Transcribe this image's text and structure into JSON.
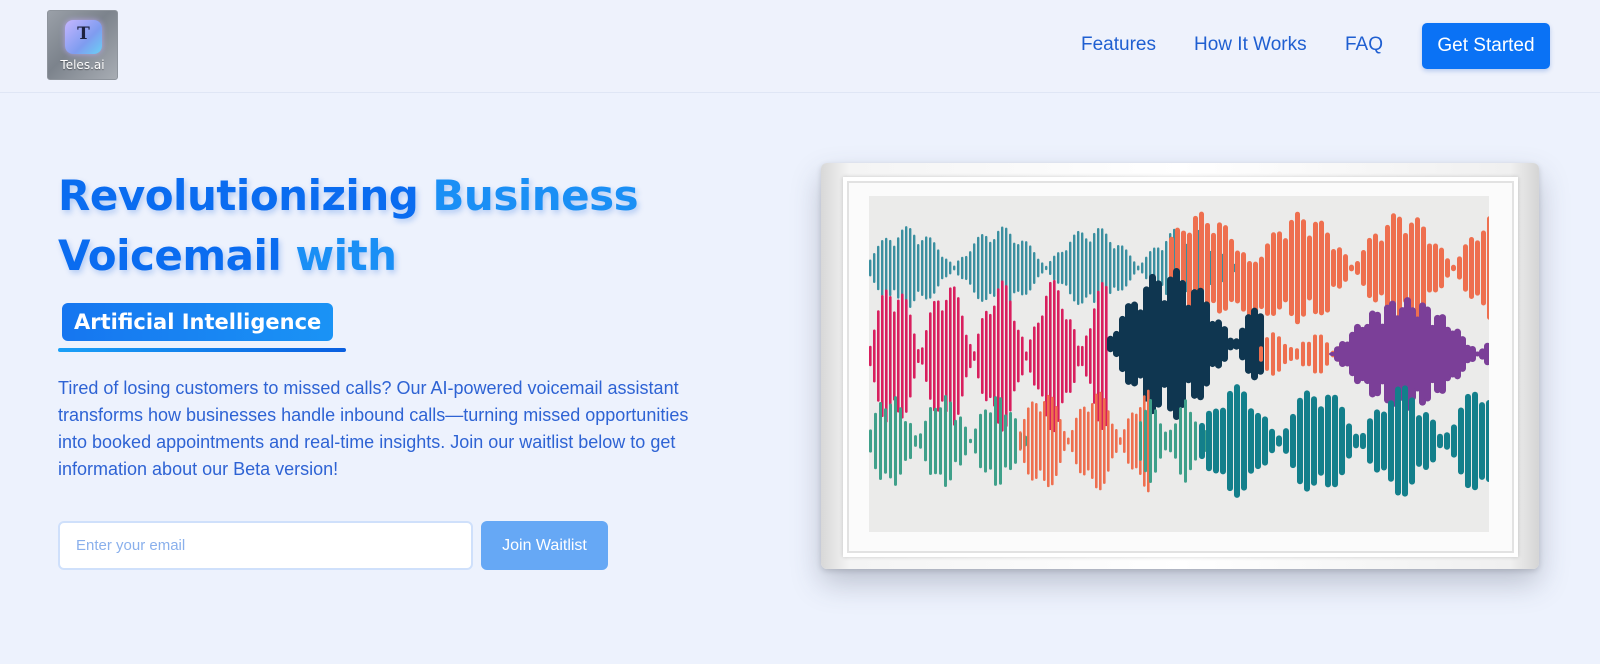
{
  "header": {
    "logo_text": "Teles.ai",
    "nav": [
      "Features",
      "How It Works",
      "FAQ"
    ],
    "cta_label": "Get Started"
  },
  "hero": {
    "headline_words": [
      "Revolutionizing",
      "Business",
      "Voicemail",
      "with"
    ],
    "badge": "Artificial Intelligence",
    "description": "Tired of losing customers to missed calls? Our AI-powered voicemail assistant transforms how businesses handle inbound calls—turning missed opportunities into booked appointments and real-time insights. Join our waitlist below to get information about our Beta version!",
    "email_placeholder": "Enter your email",
    "join_label": "Join Waitlist"
  },
  "colors": {
    "accent": "#0a72f5",
    "background": "#edf2fd",
    "wave_teal": "#3a8fa0",
    "wave_pink": "#d81f5e",
    "wave_navy": "#0f3650",
    "wave_orange": "#ee6f4f",
    "wave_purple": "#7b3f98",
    "wave_green": "#3fa08a",
    "wave_deepteal": "#137f8b"
  },
  "icons": {
    "logo": "phone-t-logo-icon"
  }
}
